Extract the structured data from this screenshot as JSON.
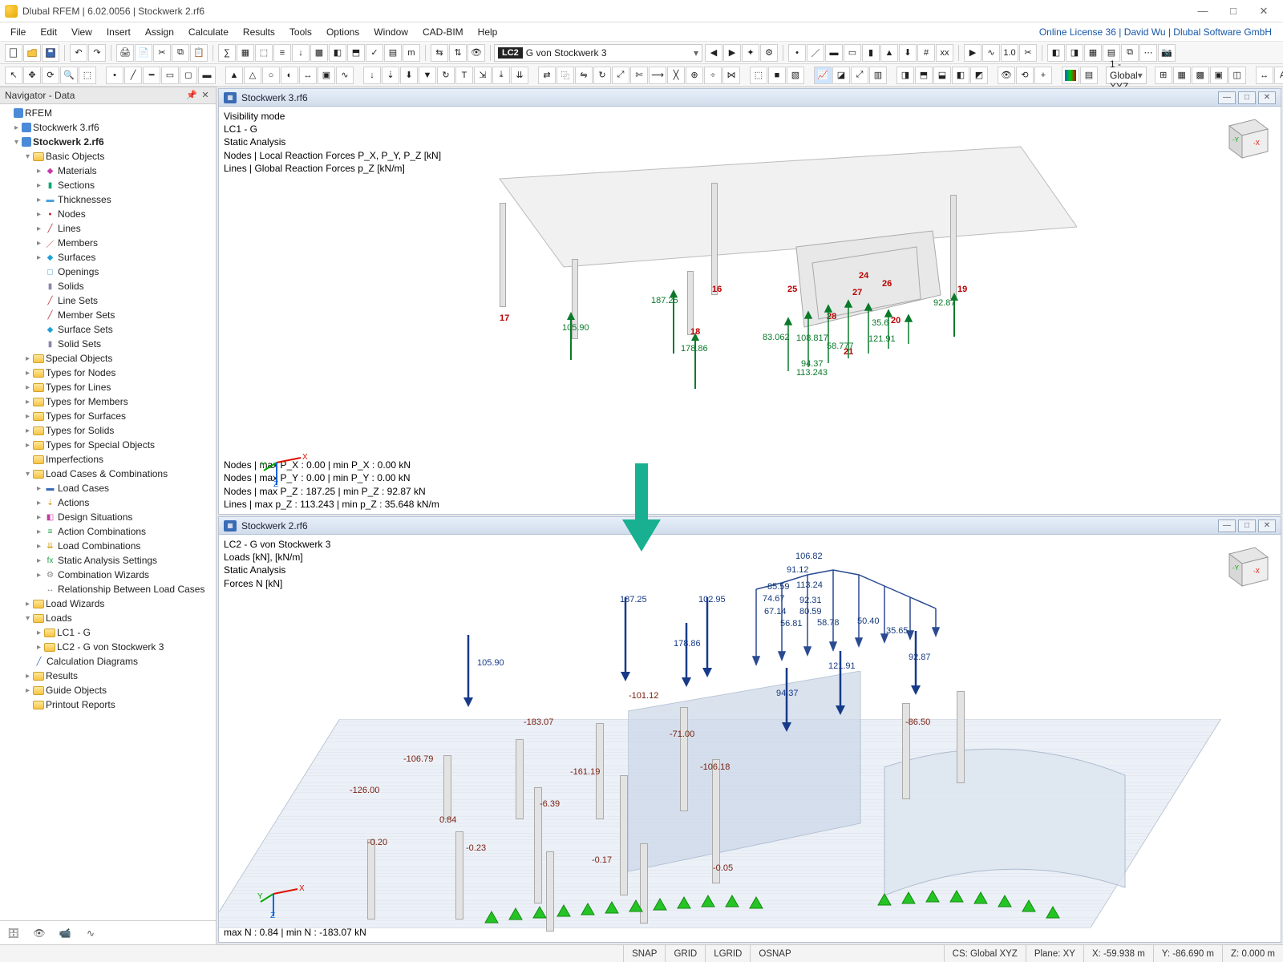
{
  "window": {
    "title": "Dlubal RFEM | 6.02.0056 | Stockwerk 2.rf6",
    "license": "Online License 36 | David Wu | Dlubal Software GmbH"
  },
  "menu": [
    "File",
    "Edit",
    "View",
    "Insert",
    "Assign",
    "Calculate",
    "Results",
    "Tools",
    "Options",
    "Window",
    "CAD-BIM",
    "Help"
  ],
  "toolbar": {
    "lc_badge": "LC2",
    "lc_label": "G von Stockwerk 3",
    "coord_sys": "1 - Global XYZ"
  },
  "navigator": {
    "title": "Navigator - Data",
    "root": "RFEM",
    "files": [
      "Stockwerk 3.rf6",
      "Stockwerk 2.rf6"
    ],
    "basic_objects": "Basic Objects",
    "basic_items": [
      "Materials",
      "Sections",
      "Thicknesses",
      "Nodes",
      "Lines",
      "Members",
      "Surfaces",
      "Openings",
      "Solids",
      "Line Sets",
      "Member Sets",
      "Surface Sets",
      "Solid Sets"
    ],
    "groups1": [
      "Special Objects",
      "Types for Nodes",
      "Types for Lines",
      "Types for Members",
      "Types for Surfaces",
      "Types for Solids",
      "Types for Special Objects",
      "Imperfections"
    ],
    "lcc": "Load Cases & Combinations",
    "lcc_items": [
      "Load Cases",
      "Actions",
      "Design Situations",
      "Action Combinations",
      "Load Combinations",
      "Static Analysis Settings",
      "Combination Wizards",
      "Relationship Between Load Cases"
    ],
    "load_wiz": "Load Wizards",
    "loads": "Loads",
    "load_cases": [
      "LC1 - G",
      "LC2 - G von Stockwerk 3"
    ],
    "tail": [
      "Calculation Diagrams",
      "Results",
      "Guide Objects",
      "Printout Reports"
    ]
  },
  "pane_top": {
    "title": "Stockwerk 3.rf6",
    "info_tl": [
      "Visibility mode",
      "LC1 - G",
      "Static Analysis",
      "Nodes | Local Reaction Forces P_X, P_Y, P_Z [kN]",
      "Lines | Global Reaction Forces p_Z [kN/m]"
    ],
    "info_bl": [
      "Nodes | max P_X : 0.00 | min P_X : 0.00 kN",
      "Nodes | max P_Y : 0.00 | min P_Y : 0.00 kN",
      "Nodes | max P_Z : 187.25 | min P_Z : 92.87 kN",
      "Lines | max p_Z : 113.243 | min p_Z : 35.648 kN/m"
    ],
    "node_labels": {
      "16": "16",
      "17": "17",
      "18": "18",
      "19": "19",
      "20": "20",
      "21": "21",
      "24": "24",
      "25": "25",
      "26": "26",
      "27": "27",
      "28": "28"
    },
    "values": {
      "v105": "105.90",
      "v187": "187.25",
      "v178": "178.86",
      "v9287": "92.87",
      "v8306": "83.062",
      "v10881": "108.817",
      "v356": "35.6",
      "v12191": "121.91",
      "v5877": "58.777",
      "v9437": "94.37",
      "v113": "113.243"
    }
  },
  "pane_bot": {
    "title": "Stockwerk 2.rf6",
    "info_tl": [
      "LC2 - G von Stockwerk 3",
      "Loads [kN], [kN/m]",
      "Static Analysis",
      "Forces N [kN]"
    ],
    "info_bl": [
      "max N : 0.84 | min N : -183.07 kN"
    ],
    "loads": {
      "l187": "187.25",
      "l102": "102.95",
      "l178": "178.86",
      "l105": "105.90",
      "l9287": "92.87",
      "l12191": "121.91",
      "l9437": "94.37"
    },
    "line_vals": {
      "a10682": "106.82",
      "a9312": "91.12",
      "a8559": "85.59",
      "a11324": "113.24",
      "a7467": "74.67",
      "a9231": "92.31",
      "a6714": "67.14",
      "a8059": "80.59",
      "a5681": "56.81",
      "a5878": "58.78",
      "a5040": "50.40",
      "a3565": "35.65"
    },
    "col_vals": {
      "c183": "-183.07",
      "c106": "-106.79",
      "c161": "-161.19",
      "c126": "-126.00",
      "c101": "-101.12",
      "c10618": "-106.18",
      "c8650": "-86.50",
      "c639": "-6.39",
      "c017": "-0.17",
      "c084": "0.84",
      "c020": "-0.20",
      "c023": "-0.23",
      "c005": "-0.05",
      "c71": "-71.00"
    }
  },
  "status": {
    "snap": "SNAP",
    "grid": "GRID",
    "lgrid": "LGRID",
    "osnap": "OSNAP",
    "cs": "CS: Global XYZ",
    "plane": "Plane: XY",
    "x": "X: -59.938 m",
    "y": "Y: -86.690 m",
    "z": "Z: 0.000 m"
  }
}
